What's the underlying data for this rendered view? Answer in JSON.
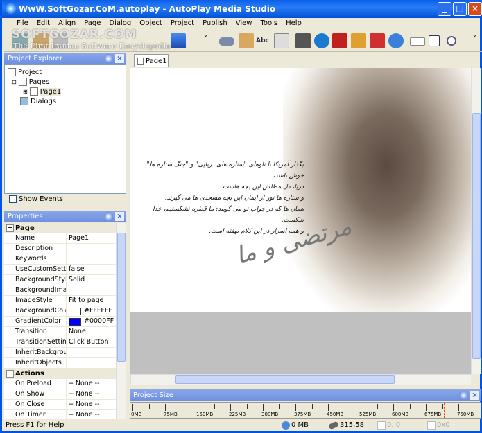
{
  "window": {
    "title": "WwW.SoftGozar.CoM.autoplay - AutoPlay Media Studio"
  },
  "menu": [
    "File",
    "Edit",
    "Align",
    "Page",
    "Dialog",
    "Object",
    "Project",
    "Publish",
    "View",
    "Tools",
    "Help"
  ],
  "watermark": {
    "line1": "SOFTGOZAR.COM",
    "line2": "The First Iranian Software Encyclopedia"
  },
  "toolbar": {
    "text_button": "Abc"
  },
  "project_explorer": {
    "title": "Project Explorer",
    "tree": [
      "Project",
      "Pages",
      "Page1",
      "Dialogs"
    ],
    "show_events": "Show Events"
  },
  "properties": {
    "title": "Properties",
    "categories": [
      {
        "name": "Page",
        "rows": [
          [
            "Name",
            "Page1"
          ],
          [
            "Description",
            ""
          ],
          [
            "Keywords",
            ""
          ],
          [
            "UseCustomSettin",
            "false"
          ],
          [
            "BackgroundStyle",
            "Solid"
          ],
          [
            "BackgroundImage",
            ""
          ],
          [
            "ImageStyle",
            "Fit to page"
          ],
          [
            "BackgroundColor",
            "#FFFFFF"
          ],
          [
            "GradientColor",
            "#0000FF"
          ],
          [
            "Transition",
            "None"
          ],
          [
            "TransitionSettings",
            "Click Button"
          ],
          [
            "InheritBackgroun",
            ""
          ],
          [
            "InheritObjects",
            ""
          ]
        ]
      },
      {
        "name": "Actions",
        "rows": [
          [
            "On Preload",
            "-- None --"
          ],
          [
            "On Show",
            "-- None --"
          ],
          [
            "On Close",
            "-- None --"
          ],
          [
            "On Timer",
            "-- None --"
          ]
        ]
      }
    ]
  },
  "tab": {
    "label": "Page1"
  },
  "page_content": {
    "lines": [
      "بگذار آمریکا با ناوهای \"ستاره های دریایی\" و \"جنگ ستاره ها\" خوش باشد،",
      "دریا، دل مطلش این بچه هاست",
      "و ستاره ها نور از ایمان این بچه مسجدی ها می گیرند،",
      "همان ها که در جواب تو می گویند: ما قطره نشکستیم، خدا شکست.",
      "و همه اسرار در این کلام نهفته است."
    ],
    "signature": "مرتضی و ما"
  },
  "project_size": {
    "title": "Project Size",
    "ticks": [
      "0MB",
      "75MB",
      "150MB",
      "225MB",
      "300MB",
      "375MB",
      "450MB",
      "525MB",
      "600MB",
      "675MB",
      "750MB"
    ]
  },
  "status": {
    "help": "Press F1 for Help",
    "size": "0 MB",
    "cursor": "315,58",
    "position": "0, 0",
    "dimensions": "0x0"
  },
  "colors": {
    "background": "#FFFFFF",
    "gradient": "#0000FF",
    "titlebar": "#0054E3"
  }
}
